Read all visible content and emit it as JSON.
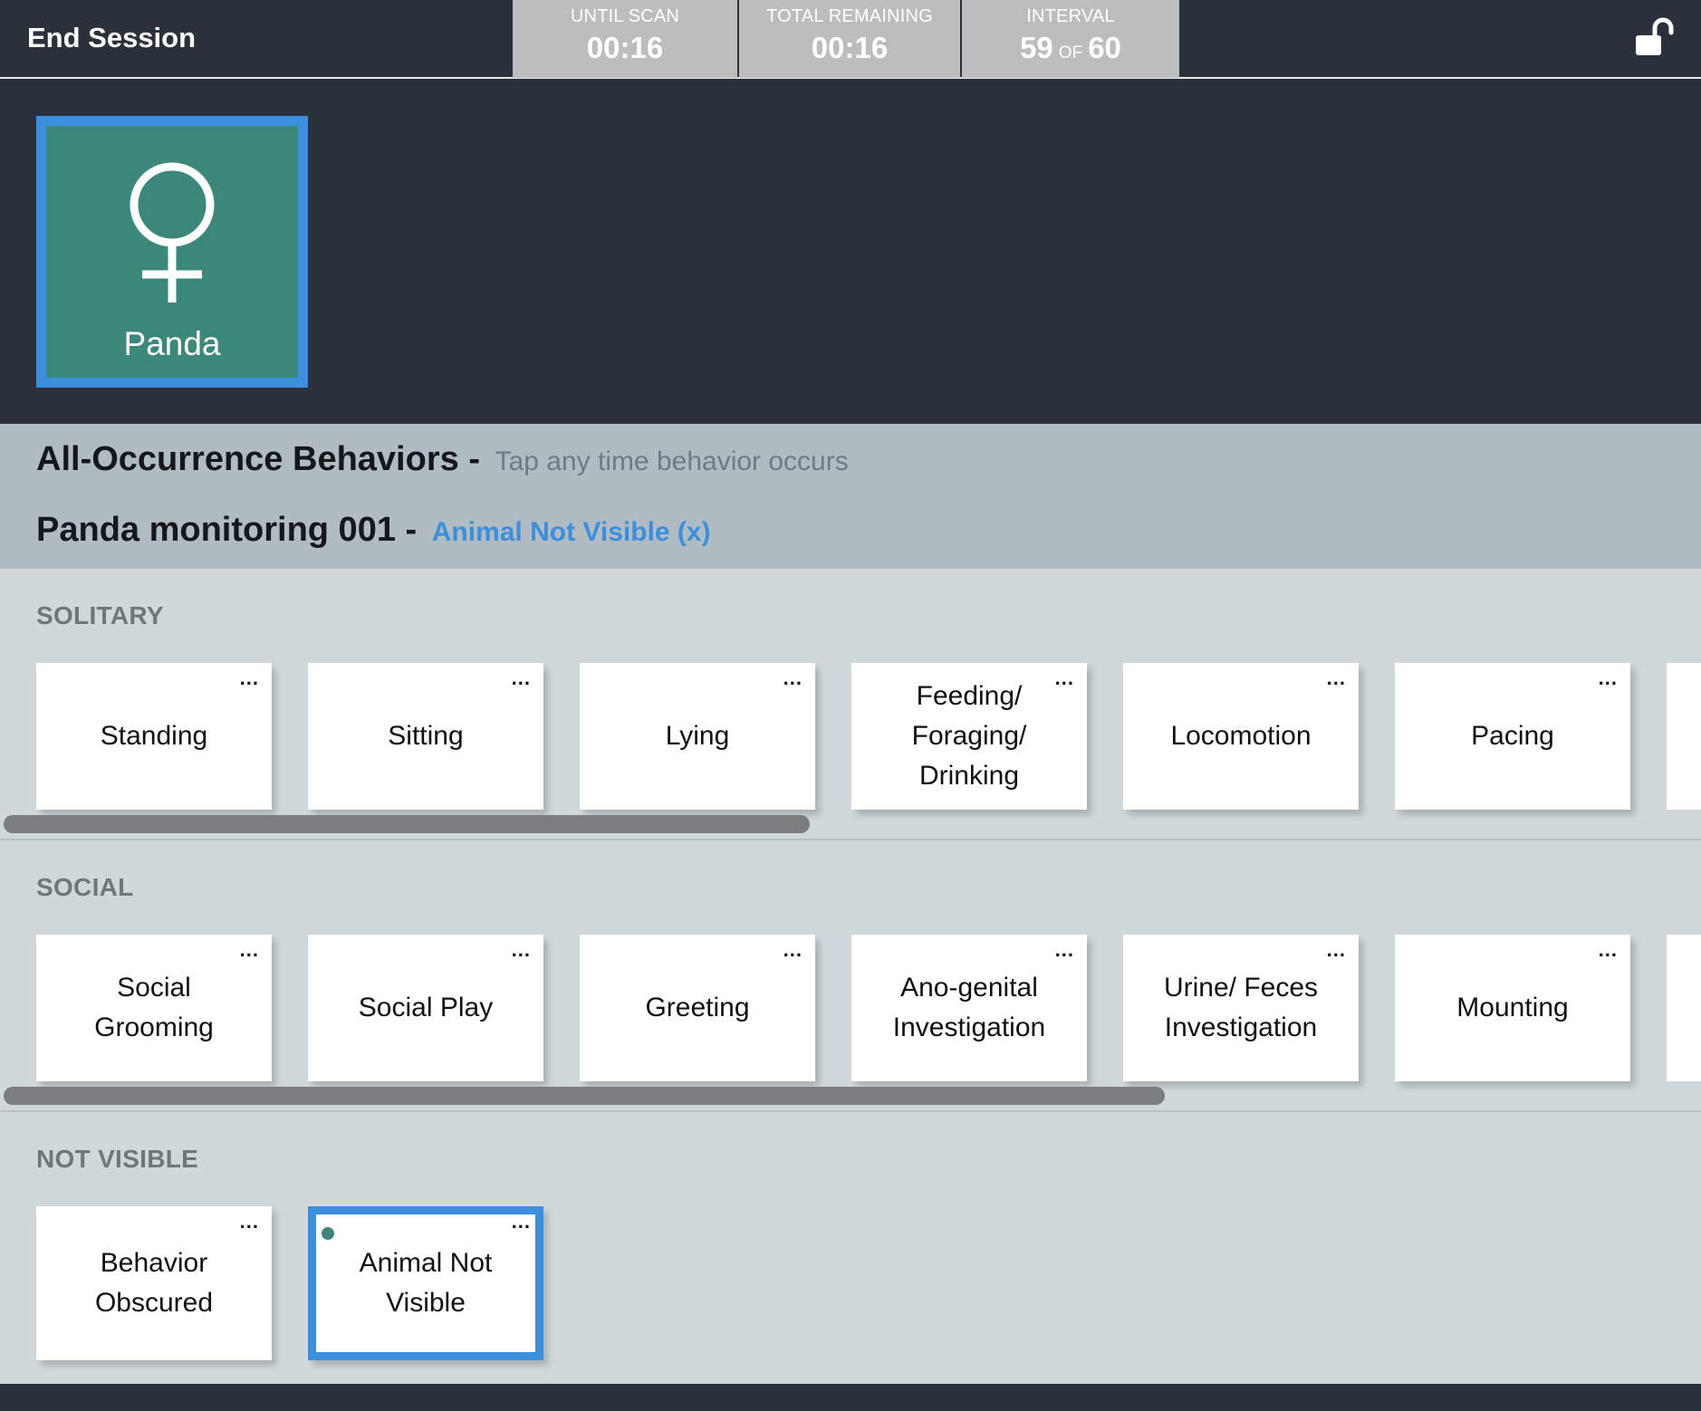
{
  "header": {
    "end_session_label": "End Session",
    "until_scan": {
      "label": "UNTIL SCAN",
      "value": "00:16"
    },
    "total_remaining": {
      "label": "TOTAL REMAINING",
      "value": "00:16"
    },
    "interval": {
      "label": "INTERVAL",
      "current": "59",
      "of": "OF",
      "total": "60"
    },
    "lock_icon": "unlocked-padlock-icon"
  },
  "animal": {
    "name": "Panda",
    "icon": "female-symbol-icon",
    "selected": true
  },
  "titles": {
    "all_occurrence": "All-Occurrence Behaviors",
    "separator": "-",
    "all_occurrence_hint": "Tap any time behavior occurs",
    "session_name": "Panda monitoring 001",
    "status_link": "Animal Not Visible (x)"
  },
  "sections": {
    "solitary": {
      "title": "SOLITARY",
      "items": [
        "Standing",
        "Sitting",
        "Lying",
        "Feeding/ Foraging/ Drinking",
        "Locomotion",
        "Pacing"
      ]
    },
    "social": {
      "title": "SOCIAL",
      "items": [
        "Social Grooming",
        "Social Play",
        "Greeting",
        "Ano-genital Investigation",
        "Urine/ Feces Investigation",
        "Mounting"
      ]
    },
    "not_visible": {
      "title": "NOT VISIBLE",
      "items": [
        "Behavior Obscured",
        "Animal Not Visible"
      ],
      "selected": "Animal Not Visible"
    }
  },
  "card_menu_glyph": "...",
  "colors": {
    "header_bg": "#2a313a",
    "stat_bg": "#bdbdbd",
    "animal_tile": "#3b887a",
    "selection_blue": "#3b8fdc",
    "titles_band": "#b1bcc2",
    "behaviors_bg": "#d0d8dc"
  }
}
